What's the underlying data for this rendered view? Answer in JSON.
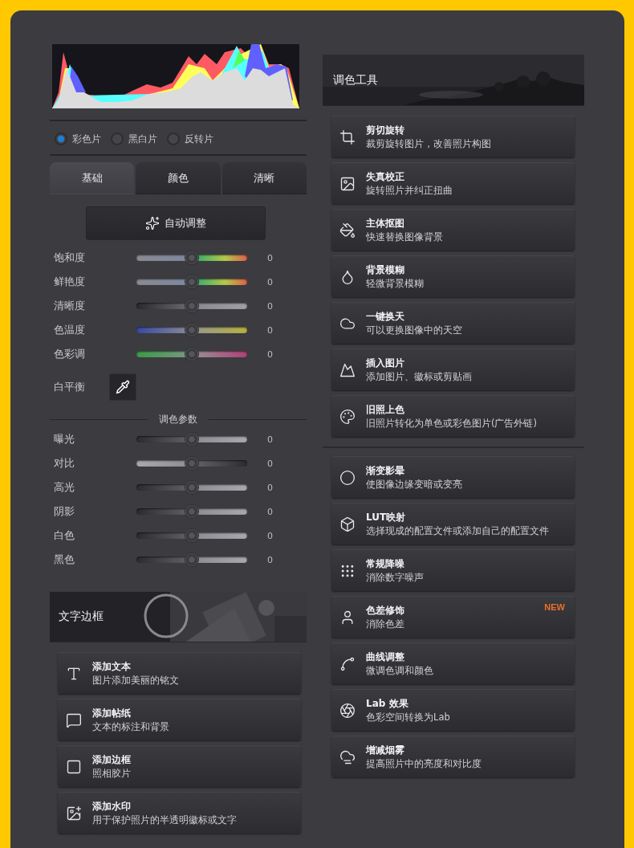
{
  "film_modes": [
    {
      "label": "彩色片",
      "selected": true
    },
    {
      "label": "黑白片",
      "selected": false
    },
    {
      "label": "反转片",
      "selected": false
    }
  ],
  "tabs": [
    {
      "label": "基础",
      "selected": true
    },
    {
      "label": "颜色",
      "selected": false
    },
    {
      "label": "清晰",
      "selected": false
    }
  ],
  "auto_button": {
    "label": "自动调整"
  },
  "basic_sliders": [
    {
      "label": "饱和度",
      "kind": "saturation",
      "level": 0.5,
      "reading": "0"
    },
    {
      "label": "鲜艳度",
      "kind": "vibrance",
      "level": 0.5,
      "reading": "0"
    },
    {
      "label": "清晰度",
      "kind": "clarity",
      "level": 0.5,
      "reading": "0"
    },
    {
      "label": "色温度",
      "kind": "temperature",
      "level": 0.5,
      "reading": "0"
    },
    {
      "label": "色彩调",
      "kind": "tint",
      "level": 0.5,
      "reading": "0"
    }
  ],
  "white_balance": {
    "label": "白平衡"
  },
  "section_title": "调色参数",
  "tone_sliders": [
    {
      "label": "曝光",
      "kind": "exposure",
      "level": 0.5,
      "reading": "0"
    },
    {
      "label": "对比",
      "kind": "contrast",
      "level": 0.5,
      "reading": "0"
    },
    {
      "label": "高光",
      "kind": "exposure",
      "level": 0.5,
      "reading": "0"
    },
    {
      "label": "阴影",
      "kind": "exposure",
      "level": 0.5,
      "reading": "0"
    },
    {
      "label": "白色",
      "kind": "exposure",
      "level": 0.5,
      "reading": "0"
    },
    {
      "label": "黑色",
      "kind": "exposure",
      "level": 0.5,
      "reading": "0"
    }
  ],
  "text_frame": {
    "title": "文字边框",
    "tools": [
      {
        "kind": "text",
        "title": "添加文本",
        "description": "图片添加美丽的铭文"
      },
      {
        "kind": "sticker",
        "title": "添加帖纸",
        "description": "文本的标注和背景"
      },
      {
        "kind": "border",
        "title": "添加边框",
        "description": "照相胶片"
      },
      {
        "kind": "watermark",
        "title": "添加水印",
        "description": "用于保护照片的半透明徽标或文字"
      }
    ]
  },
  "color_tools": {
    "title": "调色工具",
    "groups": [
      [
        {
          "kind": "crop",
          "title": "剪切旋转",
          "description": "裁剪旋转图片，改善照片构图"
        },
        {
          "kind": "distortion",
          "title": "失真校正",
          "description": "旋转照片并纠正扭曲"
        },
        {
          "kind": "cutout",
          "title": "主体抠图",
          "description": "快速替换图像背景"
        },
        {
          "kind": "blur",
          "title": "背景模糊",
          "description": "轻微背景模糊"
        },
        {
          "kind": "sky",
          "title": "一键换天",
          "description": "可以更换图像中的天空"
        },
        {
          "kind": "insert",
          "title": "插入图片",
          "description": "添加图片、徽标或剪贴画"
        },
        {
          "kind": "colorize",
          "title": "旧照上色",
          "description": "旧照片转化为单色或彩色图片(广告外链)"
        }
      ],
      [
        {
          "kind": "vignette",
          "title": "渐变影晕",
          "description": "使图像边缘变暗或变亮"
        },
        {
          "kind": "lut",
          "title": "LUT映射",
          "description": "选择现成的配置文件或添加自己的配置文件"
        },
        {
          "kind": "denoise",
          "title": "常规降噪",
          "description": "消除数字噪声"
        },
        {
          "kind": "chroma",
          "title": "色差修饰",
          "description": "消除色差",
          "badge": "NEW"
        },
        {
          "kind": "curves",
          "title": "曲线调整",
          "description": "微调色调和颜色"
        },
        {
          "kind": "lab",
          "title": "Lab 效果",
          "description": "色彩空间转换为Lab"
        },
        {
          "kind": "haze",
          "title": "增减烟雾",
          "description": "提高照片中的亮度和对比度"
        }
      ]
    ]
  }
}
